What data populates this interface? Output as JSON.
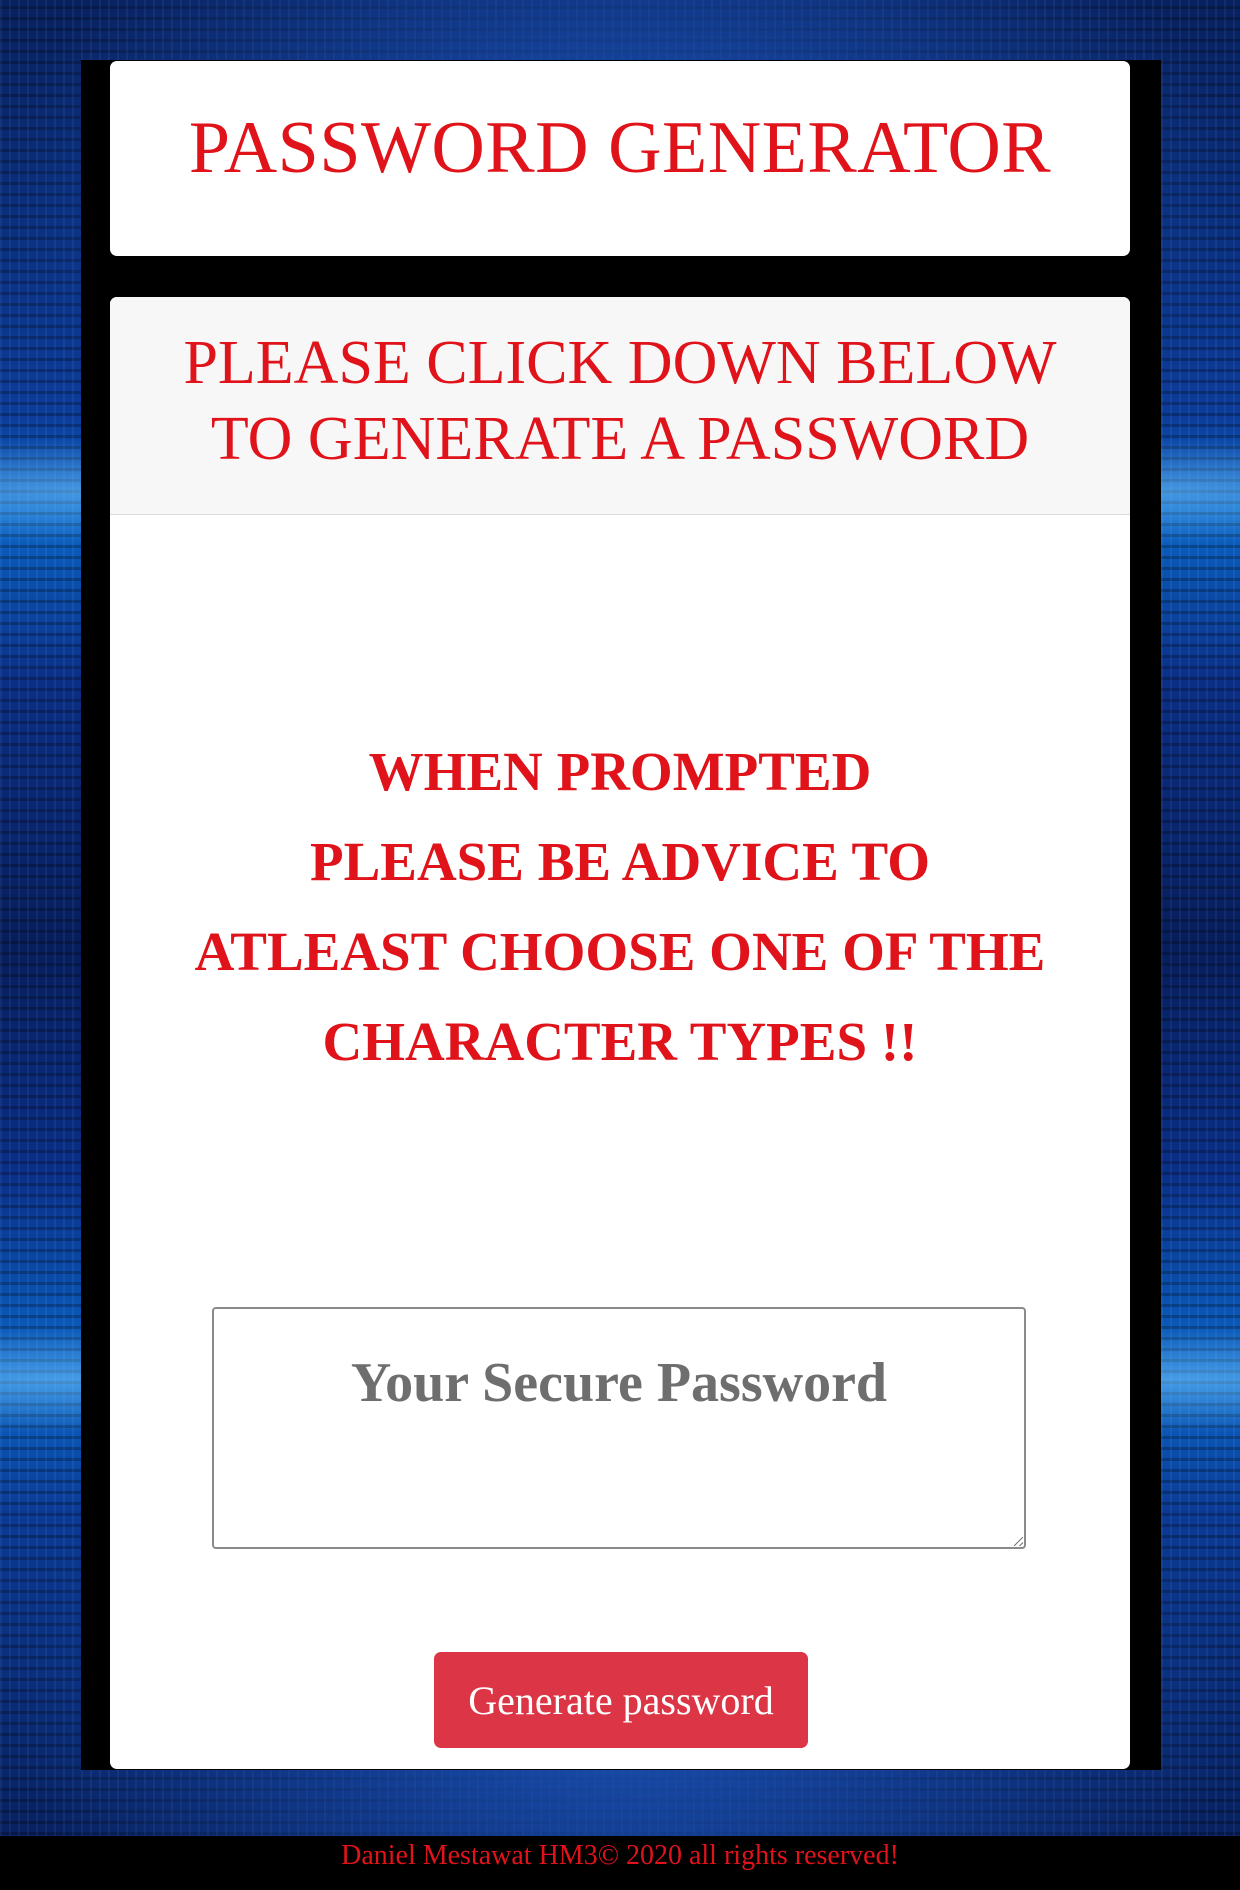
{
  "header": {
    "title": "PASSWORD GENERATOR"
  },
  "card": {
    "header_lines": [
      "PLEASE CLICK DOWN BELOW",
      "TO GENERATE A PASSWORD"
    ],
    "notice_lines": [
      "WHEN PROMPTED",
      "PLEASE BE ADVICE TO",
      "ATLEAST CHOOSE ONE OF THE",
      "CHARACTER TYPES !!"
    ],
    "password_placeholder": "Your Secure Password",
    "password_value": "",
    "generate_label": "Generate password"
  },
  "footer": {
    "text": "Daniel Mestawat HM3© 2020 all rights reserved!"
  },
  "colors": {
    "accent_red": "#e0131b",
    "button_red": "#dc3545",
    "frame": "#000000"
  }
}
